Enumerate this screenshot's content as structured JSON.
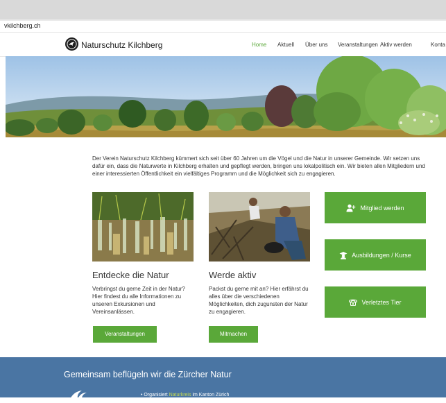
{
  "browser": {
    "url": "vkilchberg.ch"
  },
  "header": {
    "brand": "Naturschutz Kilchberg",
    "nav": [
      "Home",
      "Aktuell",
      "Über uns",
      "Veranstaltungen",
      "Aktiv werden",
      "Konta"
    ],
    "active_index": 0
  },
  "intro": "Der Verein Naturschutz Kilchberg kümmert sich seit über 60 Jahren um die Vögel und die Natur in unserer Gemeinde. Wir setzen uns dafür ein, dass die Naturwerte in Kilchberg erhalten und gepflegt werden, bringen uns lokalpolitisch ein. Wir bieten allen Mitgliedern und einer interessierten Öffentlichkeit ein vielfältiges Programm und die Möglichkeit sich zu engagieren.",
  "cards": [
    {
      "title": "Entdecke die Natur",
      "text": "Verbringst du gerne Zeit in der Natur? Hier findest du alle Informationen zu unseren Exkursionen und Vereinsanlässen.",
      "button": "Veranstaltungen"
    },
    {
      "title": "Werde aktiv",
      "text": "Packst du gerne mit an? Hier erfährst du alles über die verschiedenen Möglichkeiten, dich zugunsten der Natur zu engagieren.",
      "button": "Mitmachen"
    }
  ],
  "side_buttons": [
    {
      "label": "Mitglied werden",
      "icon": "add-user-icon"
    },
    {
      "label": "Ausbildungen / Kurse",
      "icon": "graduation-icon"
    },
    {
      "label": "Verletztes Tier",
      "icon": "phone-icon"
    }
  ],
  "footer": {
    "title": "Gemeinsam beflügeln wir die Zürcher Natur",
    "line_prefix": "Organisiert",
    "line_link": "Naturkreis",
    "line_suffix": "im Kanton Zürich"
  },
  "colors": {
    "accent": "#5aa839",
    "footer_bg": "#4a75a3",
    "link": "#c7db52"
  }
}
